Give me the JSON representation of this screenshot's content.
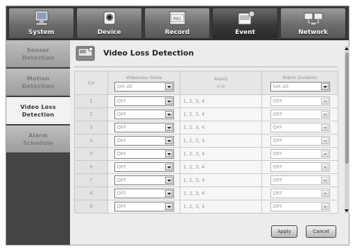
{
  "top_tabs": [
    {
      "label": "System",
      "icon": "system-icon",
      "active": false
    },
    {
      "label": "Device",
      "icon": "device-icon",
      "active": false
    },
    {
      "label": "Record",
      "icon": "record-icon",
      "active": false
    },
    {
      "label": "Event",
      "icon": "event-icon",
      "active": true
    },
    {
      "label": "Network",
      "icon": "network-icon",
      "active": false
    }
  ],
  "sidebar": {
    "items": [
      {
        "line1": "Sensor",
        "line2": "Detection",
        "active": false
      },
      {
        "line1": "Motion",
        "line2": "Detection",
        "active": false
      },
      {
        "line1": "Video Loss",
        "line2": "Detection",
        "active": true
      },
      {
        "line1": "Alarm",
        "line2": "Schedule",
        "active": false
      }
    ]
  },
  "page": {
    "title": "Video Loss Detection",
    "icon": "video-loss-icon"
  },
  "table": {
    "headers": {
      "ch": "CH",
      "state": "VideoLoss State",
      "alarm": "Alarm",
      "alarm_sub": "<>",
      "duration": "Alarm Duration"
    },
    "set_all_state": "Set All",
    "set_all_duration": "Set All",
    "rows": [
      {
        "ch": "1",
        "state": "OFF",
        "alarm": "1, 2, 3, 4",
        "duration": "OFF"
      },
      {
        "ch": "2",
        "state": "OFF",
        "alarm": "1, 2, 3, 4",
        "duration": "OFF"
      },
      {
        "ch": "3",
        "state": "OFF",
        "alarm": "1, 2, 3, 4",
        "duration": "OFF"
      },
      {
        "ch": "4",
        "state": "OFF",
        "alarm": "1, 2, 3, 4",
        "duration": "OFF"
      },
      {
        "ch": "5",
        "state": "OFF",
        "alarm": "1, 2, 3, 4",
        "duration": "OFF"
      },
      {
        "ch": "6",
        "state": "OFF",
        "alarm": "1, 2, 3, 4",
        "duration": "OFF"
      },
      {
        "ch": "7",
        "state": "OFF",
        "alarm": "1, 2, 3, 4",
        "duration": "OFF"
      },
      {
        "ch": "8",
        "state": "OFF",
        "alarm": "1, 2, 3, 4",
        "duration": "OFF"
      },
      {
        "ch": "9",
        "state": "OFF",
        "alarm": "1, 2, 3, 4",
        "duration": "OFF"
      }
    ]
  },
  "buttons": {
    "apply": "Apply",
    "cancel": "Cancel"
  },
  "colors": {
    "topbar": "#3a3a3a",
    "active_tab": "#2a2a2a",
    "active_side": "#f2f2f2"
  }
}
